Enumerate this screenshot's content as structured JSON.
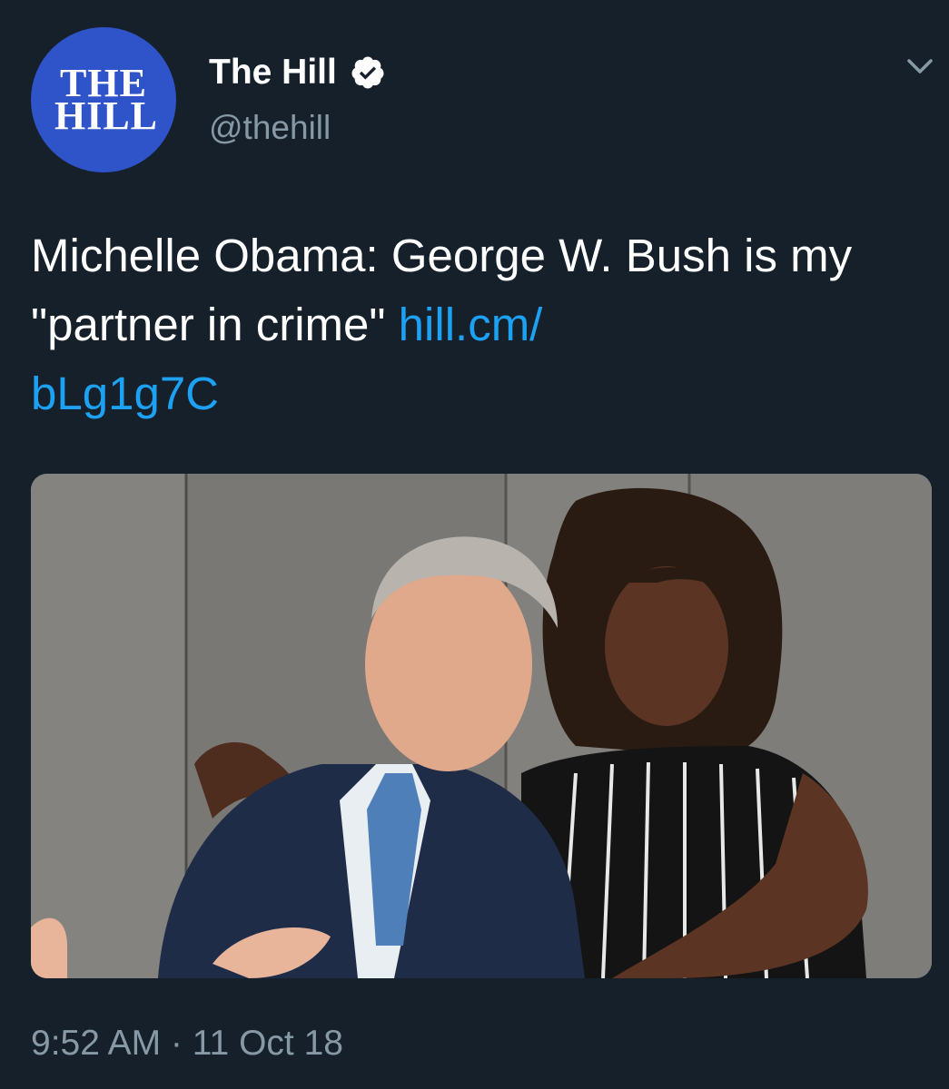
{
  "author": {
    "avatar_text_line1": "THE",
    "avatar_text_line2": "HILL",
    "display_name": "The Hill",
    "handle": "@thehill",
    "verified": true
  },
  "tweet": {
    "text": "Michelle Obama: George W. Bush is my \"partner in crime\" ",
    "link_text": "hill.cm/bLg1g7C",
    "link_line1": "hill.cm/",
    "link_line2": "bLg1g7C"
  },
  "meta": {
    "timestamp": "9:52 AM · 11 Oct 18"
  },
  "icons": {
    "verified": "verified-badge-icon",
    "more": "chevron-down-icon"
  },
  "colors": {
    "background": "#15202b",
    "text": "#ffffff",
    "secondary": "#8899a6",
    "link": "#1da1f2",
    "avatar": "#2f54c9"
  }
}
